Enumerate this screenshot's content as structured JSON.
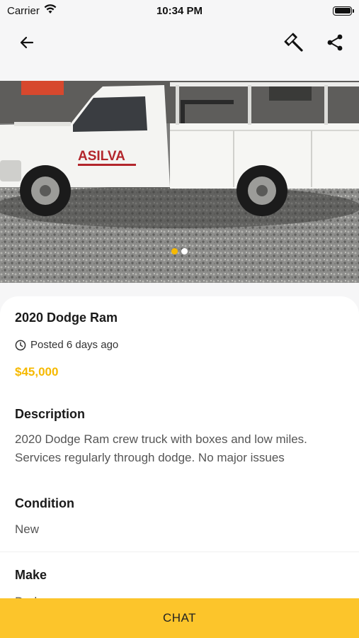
{
  "status_bar": {
    "carrier": "Carrier",
    "time": "10:34 PM"
  },
  "nav": {
    "back_icon": "arrow-left-icon",
    "auction_icon": "gavel-icon",
    "share_icon": "share-icon"
  },
  "gallery": {
    "image": "white-dodge-ram-utility-truck-photo",
    "truck_logo_text": "ASILVA",
    "page_count": 2,
    "active_page": 1
  },
  "listing": {
    "title": "2020 Dodge Ram",
    "posted": "Posted 6 days ago",
    "price": "$45,000",
    "description_heading": "Description",
    "description": "2020 Dodge Ram crew truck with boxes and low miles. Services regularly through dodge. No major issues",
    "condition_heading": "Condition",
    "condition": "New",
    "make_heading": "Make",
    "make": "Dodge"
  },
  "actions": {
    "chat_label": "CHAT"
  },
  "colors": {
    "accent": "#f6b900",
    "button": "#fcc52b"
  }
}
